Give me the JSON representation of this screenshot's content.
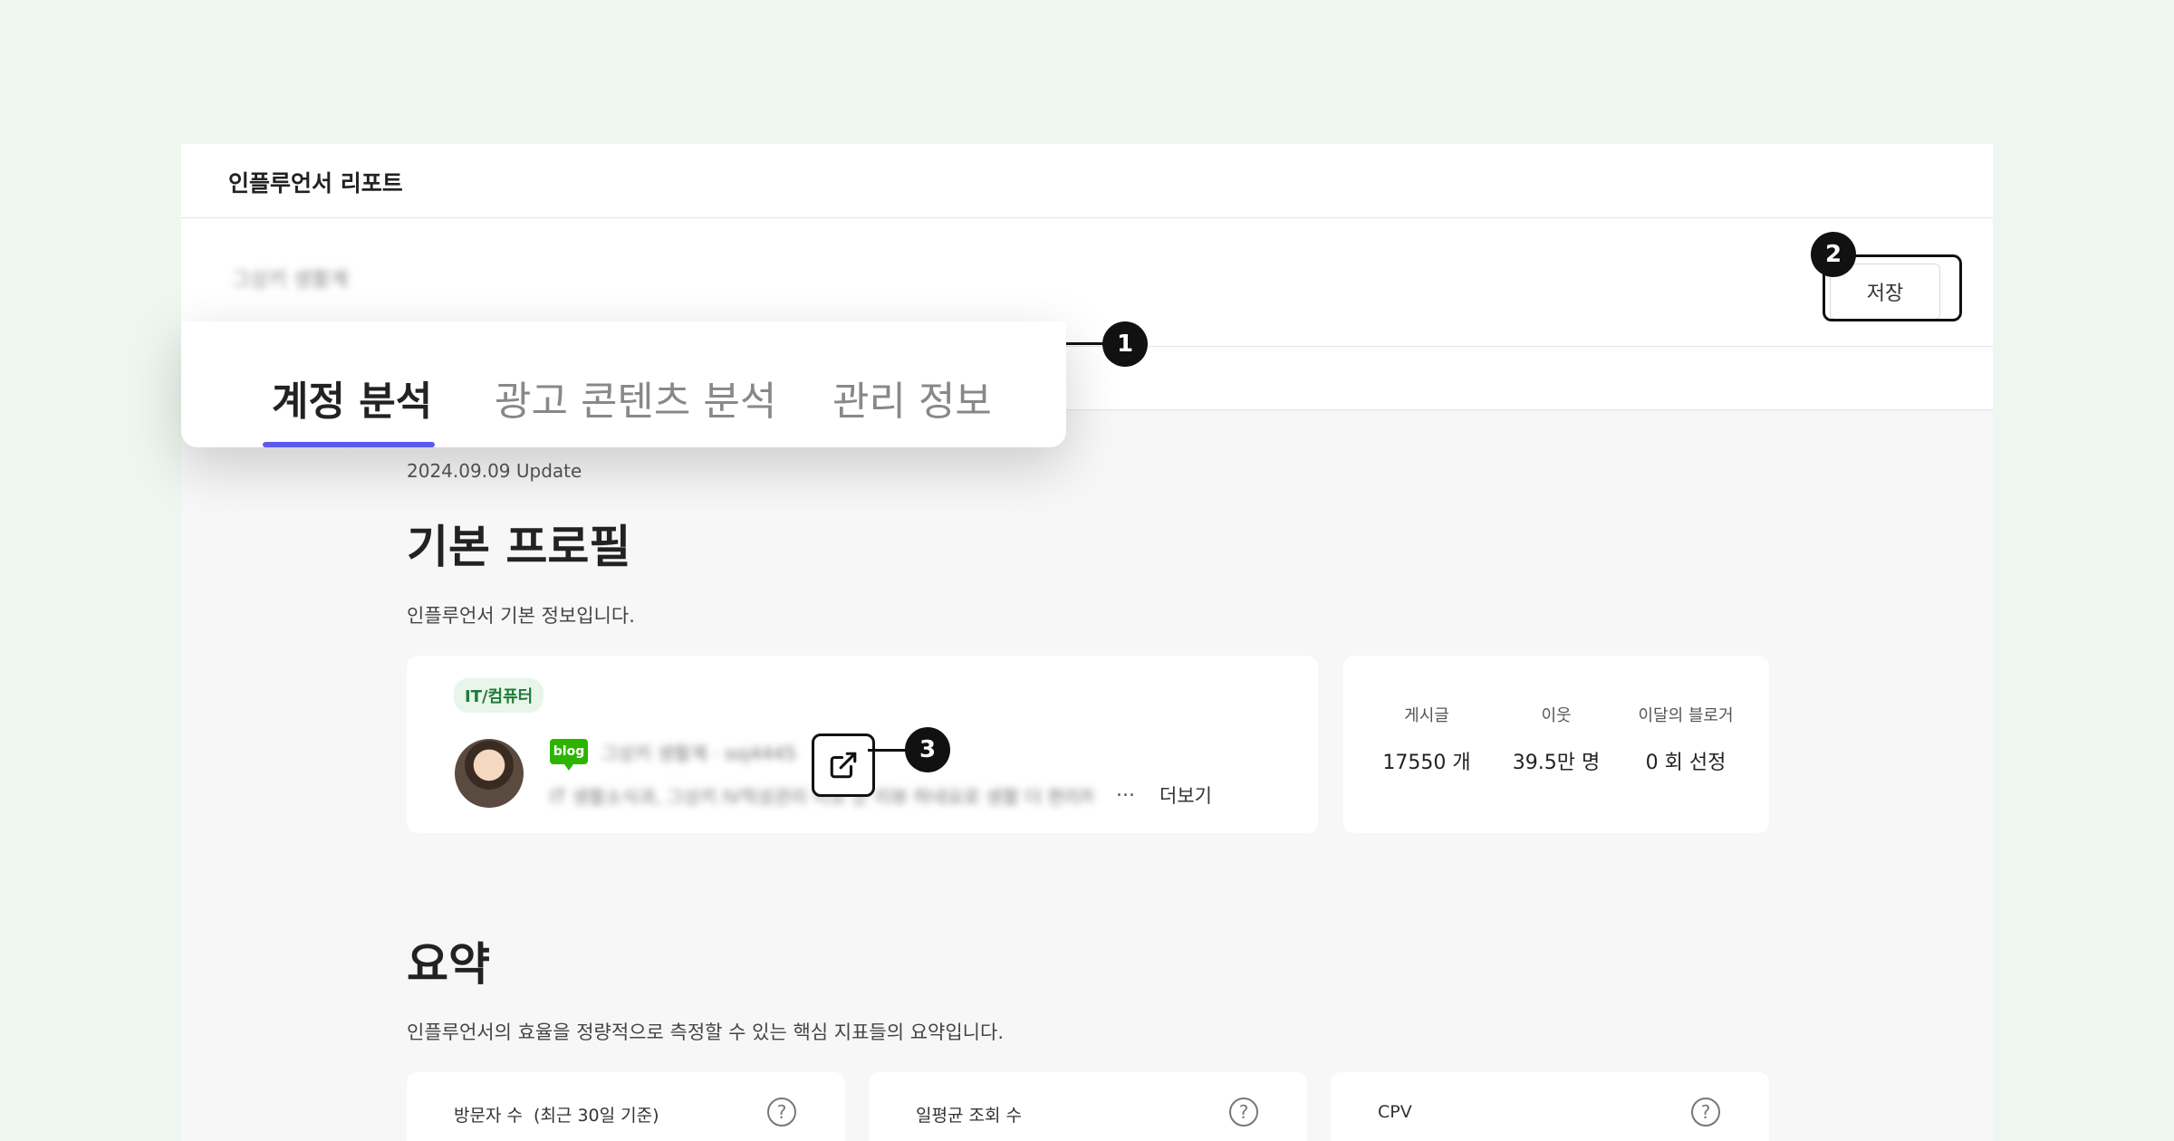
{
  "app": {
    "title": "인플루언서 리포트"
  },
  "header": {
    "blurred_name": "그상키 생활계",
    "save_label": "저장"
  },
  "tabs": [
    {
      "label": "계정 분석",
      "active": true
    },
    {
      "label": "광고 콘텐츠 분석",
      "active": false
    },
    {
      "label": "관리 정보",
      "active": false
    }
  ],
  "profile": {
    "update_date": "2024.09.09 Update",
    "heading": "기본 프로필",
    "description": "인플루언서 기본 정보입니다.",
    "category_tag": "IT/컴퓨터",
    "blog_badge": "blog",
    "blurred_blog_name": "그상키 생활계 · soj4445",
    "blurred_intro": "IT 생활소식과, 그상키 IV적성관리 이모 군 리뷰 하네요로 생활 더 편리하게",
    "ellipsis": "...",
    "more_label": "더보기"
  },
  "stats": [
    {
      "label": "게시글",
      "value": "17550 개"
    },
    {
      "label": "이웃",
      "value": "39.5만 명"
    },
    {
      "label": "이달의 블로거",
      "value": "0 회 선정"
    }
  ],
  "summary": {
    "heading": "요약",
    "description": "인플루언서의 효율을 정량적으로 측정할 수 있는 핵심 지표들의 요약입니다.",
    "metrics": [
      {
        "label": "방문자 수  (최근 30일 기준)"
      },
      {
        "label": "일평균 조회 수"
      },
      {
        "label": "CPV"
      }
    ]
  },
  "callouts": [
    "1",
    "2",
    "3"
  ],
  "colors": {
    "accent": "#5b5bf0",
    "background": "#eef7ef",
    "tag_bg": "#e8f5ea",
    "blog_green": "#2db400"
  },
  "icons": [
    "external-link-icon",
    "help-icon",
    "blog-icon"
  ]
}
